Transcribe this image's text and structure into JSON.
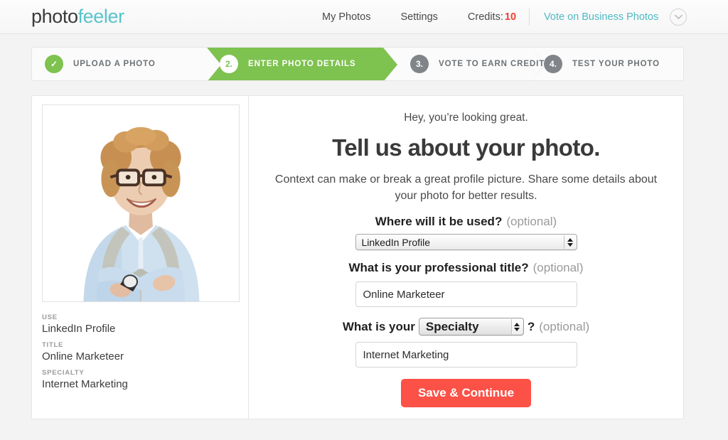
{
  "brand": {
    "logo_primary": "photo",
    "logo_secondary": "feeler",
    "accent_teal": "#57c4cb",
    "accent_green": "#7ec24f",
    "accent_red": "#fc5147",
    "accent_button": "#fc5147"
  },
  "header": {
    "nav": [
      {
        "label": "My Photos"
      },
      {
        "label": "Settings"
      }
    ],
    "credits_label": "Credits:",
    "credits_count": "10",
    "vote_link": "Vote on Business Photos",
    "account_menu_icon": "chevron-down-icon"
  },
  "steps": [
    {
      "badge": "✓",
      "label": "UPLOAD A PHOTO",
      "state": "done"
    },
    {
      "badge": "2.",
      "label": "ENTER PHOTO DETAILS",
      "state": "active"
    },
    {
      "badge": "3.",
      "label": "VOTE TO EARN CREDITS",
      "state": "todo"
    },
    {
      "badge": "4.",
      "label": "TEST YOUR PHOTO",
      "state": "todo"
    }
  ],
  "sidebar": {
    "photo_alt": "portrait-photo",
    "summary": [
      {
        "key": "USE",
        "value": "LinkedIn Profile"
      },
      {
        "key": "TITLE",
        "value": "Online Marketeer"
      },
      {
        "key": "SPECIALTY",
        "value": "Internet Marketing"
      }
    ]
  },
  "form": {
    "tagline": "Hey, you’re looking great.",
    "headline": "Tell us about your photo.",
    "subtext": "Context can make or break a great profile picture. Share some details about your photo for better results.",
    "use_label": "Where will it be used?",
    "use_optional": "(optional)",
    "use_value": "LinkedIn Profile",
    "title_label": "What is your professional title?",
    "title_optional": "(optional)",
    "title_value": "Online Marketeer",
    "title_placeholder": "Online Marketeer",
    "specialty_label_prefix": "What is your",
    "specialty_select_value": "Specialty",
    "specialty_label_suffix": "?",
    "specialty_optional": "(optional)",
    "specialty_value": "Internet Marketing",
    "specialty_placeholder": "Internet Marketing",
    "submit_label": "Save & Continue"
  }
}
